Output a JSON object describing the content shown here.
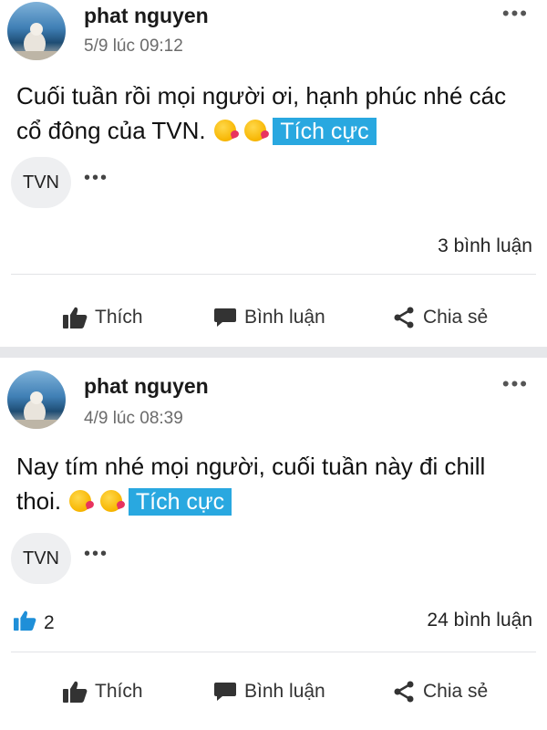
{
  "posts": [
    {
      "author": "phat nguyen",
      "time": "5/9 lúc 09:12",
      "more": "•••",
      "text_line1": "Cuối tuần rồi mọi người ơi, hạnh phúc nhé các",
      "text_line2": "cổ đông của TVN.",
      "emojis": [
        "kiss-emoji",
        "kiss-emoji"
      ],
      "tag": "Tích cực",
      "chip": "TVN",
      "chip_more": "•••",
      "likes": "",
      "comments": "3 bình luận",
      "actions": {
        "like": "Thích",
        "comment": "Bình luận",
        "share": "Chia sẻ"
      }
    },
    {
      "author": "phat nguyen",
      "time": "4/9 lúc 08:39",
      "more": "•••",
      "text_line1": "Nay tím nhé mọi người, cuối tuần này đi chill",
      "text_line2": "thoi.",
      "emojis": [
        "kiss-emoji",
        "kiss-emoji"
      ],
      "tag": "Tích cực",
      "chip": "TVN",
      "chip_more": "•••",
      "likes": "2",
      "comments": "24 bình luận",
      "actions": {
        "like": "Thích",
        "comment": "Bình luận",
        "share": "Chia sẻ"
      }
    }
  ],
  "colors": {
    "tag_bg": "#29a8e0",
    "like_blue": "#1f8fd8",
    "separator": "#e6e7ea"
  }
}
